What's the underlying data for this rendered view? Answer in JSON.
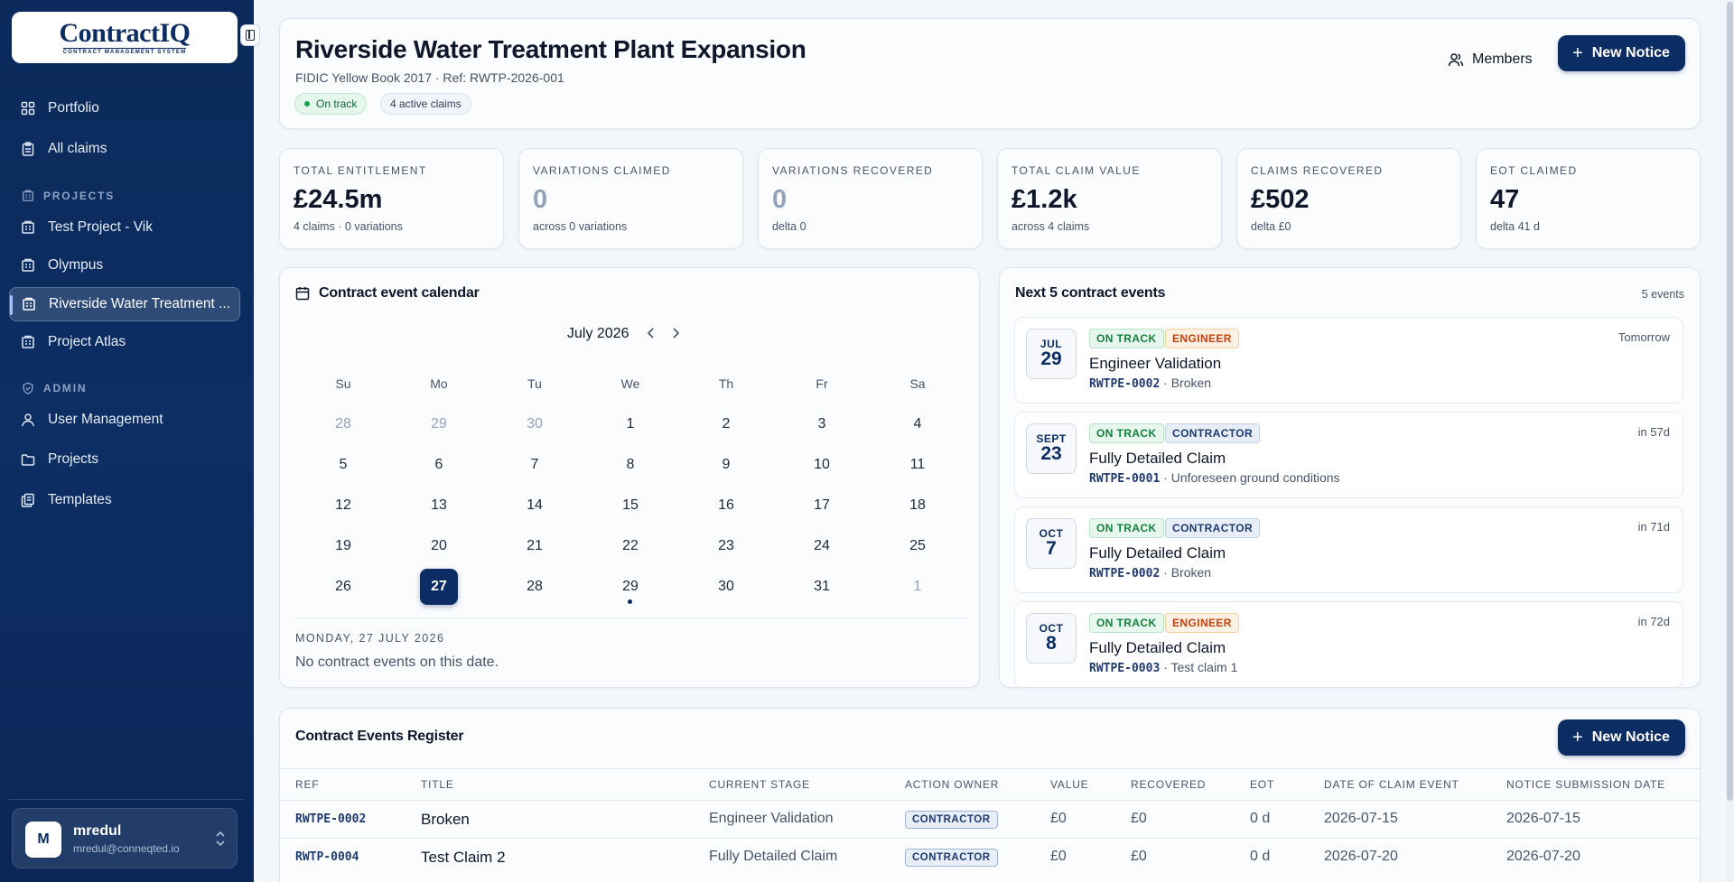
{
  "app": {
    "logo_text": "ContractIQ",
    "logo_sub": "CONTRACT MANAGEMENT SYSTEM"
  },
  "sidebar": {
    "top_items": [
      {
        "label": "Portfolio",
        "icon": "grid-icon"
      },
      {
        "label": "All claims",
        "icon": "clipboard-icon"
      }
    ],
    "projects_heading": "PROJECTS",
    "projects": [
      {
        "label": "Test Project - Vik",
        "icon": "building-icon"
      },
      {
        "label": "Olympus",
        "icon": "building-icon"
      },
      {
        "label": "Riverside Water Treatment ...",
        "icon": "building-icon",
        "active": true
      },
      {
        "label": "Project Atlas",
        "icon": "building-icon"
      }
    ],
    "admin_heading": "ADMIN",
    "admin_items": [
      {
        "label": "User Management",
        "icon": "user-icon"
      },
      {
        "label": "Projects",
        "icon": "folder-icon"
      },
      {
        "label": "Templates",
        "icon": "templates-icon"
      }
    ],
    "user": {
      "initial": "M",
      "name": "mredul",
      "email": "mredul@conneqted.io"
    }
  },
  "header": {
    "title": "Riverside Water Treatment Plant Expansion",
    "subtitle": "FIDIC Yellow Book 2017 · Ref: RWTP-2026-001",
    "status": "On track",
    "claims_badge": "4 active claims",
    "members_label": "Members",
    "new_notice_label": "New Notice"
  },
  "stats": [
    {
      "label": "TOTAL ENTITLEMENT",
      "value": "£24.5m",
      "sub": "4 claims · 0 variations",
      "muted": false
    },
    {
      "label": "VARIATIONS CLAIMED",
      "value": "0",
      "sub": "across 0 variations",
      "muted": true
    },
    {
      "label": "VARIATIONS RECOVERED",
      "value": "0",
      "sub": "delta 0",
      "muted": true
    },
    {
      "label": "TOTAL CLAIM VALUE",
      "value": "£1.2k",
      "sub": "across 4 claims",
      "muted": false
    },
    {
      "label": "CLAIMS RECOVERED",
      "value": "£502",
      "sub": "delta £0",
      "muted": false
    },
    {
      "label": "EOT CLAIMED",
      "value": "47",
      "sub": "delta 41 d",
      "muted": false
    }
  ],
  "calendar": {
    "title": "Contract event calendar",
    "month": "July 2026",
    "weekdays": [
      "Su",
      "Mo",
      "Tu",
      "We",
      "Th",
      "Fr",
      "Sa"
    ],
    "weeks": [
      [
        "28",
        "29",
        "30",
        "1",
        "2",
        "3",
        "4"
      ],
      [
        "5",
        "6",
        "7",
        "8",
        "9",
        "10",
        "11"
      ],
      [
        "12",
        "13",
        "14",
        "15",
        "16",
        "17",
        "18"
      ],
      [
        "19",
        "20",
        "21",
        "22",
        "23",
        "24",
        "25"
      ],
      [
        "26",
        "27",
        "28",
        "29",
        "30",
        "31",
        "1"
      ]
    ],
    "selected_label": "MONDAY, 27 JULY 2026",
    "empty_text": "No contract events on this date."
  },
  "next_events": {
    "title": "Next 5 contract events",
    "count": "5 events",
    "items": [
      {
        "month": "JUL",
        "day": "29",
        "status": "ON TRACK",
        "owner": "ENGINEER",
        "title": "Engineer Validation",
        "ref": "RWTPE-0002",
        "desc": "Broken",
        "when": "Tomorrow"
      },
      {
        "month": "SEPT",
        "day": "23",
        "status": "ON TRACK",
        "owner": "CONTRACTOR",
        "title": "Fully Detailed Claim",
        "ref": "RWTPE-0001",
        "desc": "Unforeseen ground conditions",
        "when": "in 57d"
      },
      {
        "month": "OCT",
        "day": "7",
        "status": "ON TRACK",
        "owner": "CONTRACTOR",
        "title": "Fully Detailed Claim",
        "ref": "RWTPE-0002",
        "desc": "Broken",
        "when": "in 71d"
      },
      {
        "month": "OCT",
        "day": "8",
        "status": "ON TRACK",
        "owner": "ENGINEER",
        "title": "Fully Detailed Claim",
        "ref": "RWTPE-0003",
        "desc": "Test claim 1",
        "when": "in 72d"
      }
    ]
  },
  "register": {
    "title": "Contract Events Register",
    "new_notice_label": "New Notice",
    "columns": [
      "REF",
      "TITLE",
      "CURRENT STAGE",
      "ACTION OWNER",
      "VALUE",
      "RECOVERED",
      "EOT",
      "DATE OF CLAIM EVENT",
      "NOTICE SUBMISSION DATE"
    ],
    "rows": [
      [
        "RWTPE-0002",
        "Broken",
        "Engineer Validation",
        "CONTRACTOR",
        "£0",
        "£0",
        "0 d",
        "2026-07-15",
        "2026-07-15"
      ],
      [
        "RWTP-0004",
        "Test Claim 2",
        "Fully Detailed Claim",
        "CONTRACTOR",
        "£0",
        "£0",
        "0 d",
        "2026-07-20",
        "2026-07-20"
      ]
    ]
  }
}
